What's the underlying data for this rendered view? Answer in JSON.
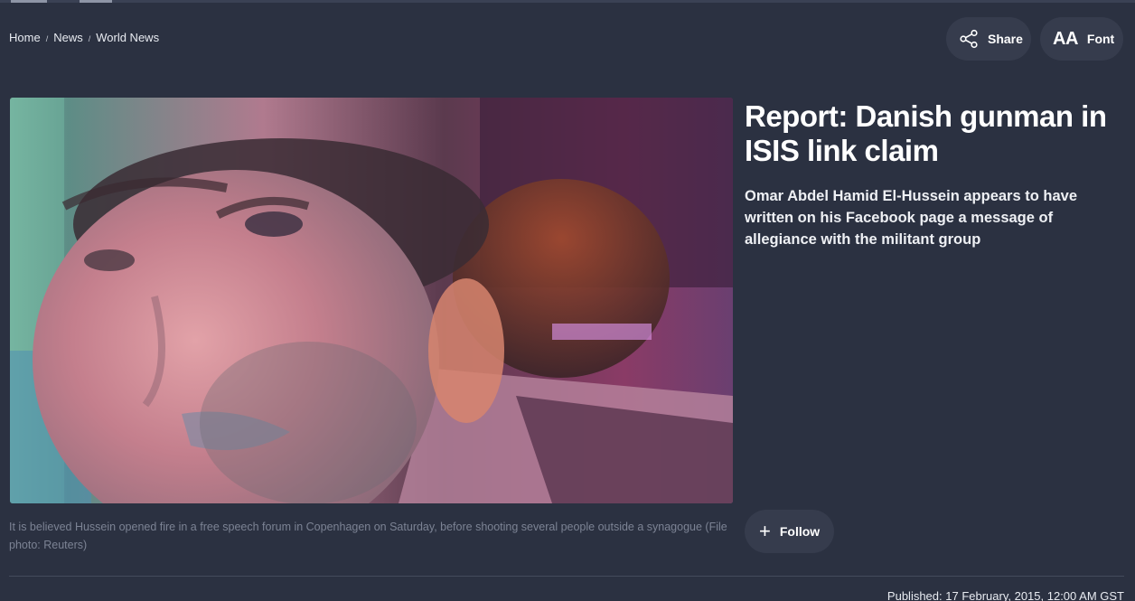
{
  "breadcrumb": {
    "home": "Home",
    "news": "News",
    "world_news": "World News",
    "separator": "/"
  },
  "toolbar": {
    "share_label": "Share",
    "font_icon_text": "AA",
    "font_label": "Font"
  },
  "article": {
    "headline": "Report: Danish gunman in ISIS link claim",
    "summary": "Omar Abdel Hamid El-Hussein appears to have written on his Facebook page a message of allegiance with the militant group",
    "image_caption": "It is believed Hussein opened fire in a free speech forum in Copenhagen on Saturday, before shooting several people outside a synagogue (File photo: Reuters)",
    "follow_label": "Follow",
    "published": "Published: 17 February, 2015, 12:00 AM GST"
  },
  "icons": {
    "share": "share-icon",
    "plus": "plus-icon"
  },
  "colors": {
    "background": "#2b3141",
    "pill_background": "#363c4d",
    "caption_text": "#7c8394"
  }
}
